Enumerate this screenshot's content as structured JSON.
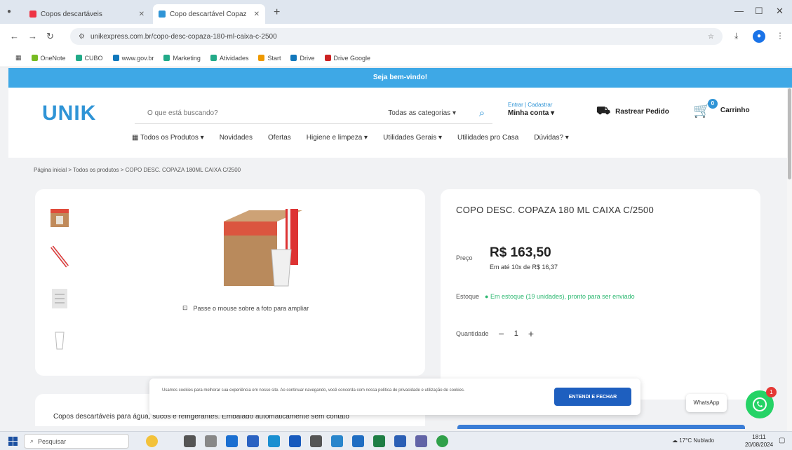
{
  "browser": {
    "tabs": [
      {
        "title": "Copos descartáveis",
        "active": false
      },
      {
        "title": "Copo descartável Copaz",
        "active": true
      }
    ],
    "url": "unikexpress.com.br/copo-desc-copaza-180-ml-caixa-c-2500",
    "bookmarks": [
      "OneNote",
      "CUBO",
      "www.gov.br",
      "Marketing",
      "Atividades",
      "Start",
      "Drive",
      "Drive Google"
    ]
  },
  "site": {
    "promo": "Seja bem-vindo!",
    "logo": "UNIK",
    "search": {
      "placeholder": "O que está buscando?",
      "category": "Todas as categorias"
    },
    "account": {
      "small": "Entrar | Cadastrar",
      "big": "Minha conta"
    },
    "track_label": "Rastrear Pedido",
    "cart": {
      "label": "Carrinho",
      "count": "0"
    },
    "menu": [
      "Todos os Produtos",
      "Novidades",
      "Ofertas",
      "Higiene e limpeza",
      "Utilidades Gerais",
      "Utilidades pro Casa",
      "Dúvidas?"
    ]
  },
  "breadcrumb": "Página inicial > Todos os produtos > COPO DESC. COPAZA 180ML CAIXA C/2500",
  "product": {
    "title": "COPO DESC. COPAZA 180 ML CAIXA C/2500",
    "price_label": "Preço",
    "price": "R$ 163,50",
    "installments": "Em até 10x de R$ 16,37",
    "stock_label": "Estoque",
    "stock_status": "Em estoque (19 unidades), pronto para ser enviado",
    "qty_label": "Quantidade",
    "qty": "1",
    "zoom_hint": "Passe o mouse sobre a foto para ampliar",
    "description": "Copos descartáveis para água, sucos e refrigerantes. Embalado automaticamente sem contato"
  },
  "cookie": {
    "message": "Usamos cookies para melhorar sua experiência em nosso site. Ao continuar navegando, você concorda com nossa política de privacidade e utilização de cookies.",
    "accept": "ENTENDI E FECHAR"
  },
  "whatsapp": {
    "label": "WhatsApp",
    "badge": "1"
  },
  "taskbar": {
    "search_placeholder": "Pesquisar",
    "weather": "17°C Nublado",
    "time": "18:11",
    "date": "20/08/2024"
  }
}
